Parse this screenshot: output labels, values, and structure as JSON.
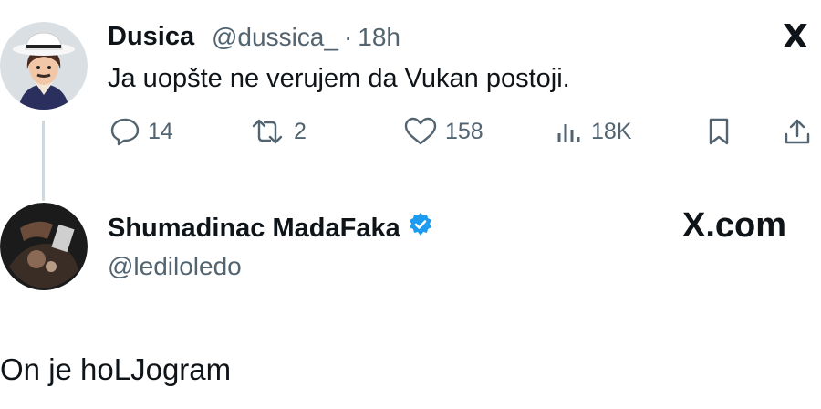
{
  "tweet": {
    "author_name": "Dusica",
    "handle": "@dussica_",
    "separator": "·",
    "time": "18h",
    "text": "Ja uopšte ne verujem da Vukan postoji.",
    "actions": {
      "replies": "14",
      "retweets": "2",
      "likes": "158",
      "views": "18K"
    },
    "platform_icon": "X"
  },
  "reply": {
    "author_name": "Shumadinac MadaFaka",
    "verified": true,
    "handle": "@lediloledo",
    "brand": "X.com",
    "text": "On je hoLJogram"
  },
  "colors": {
    "text": "#0f1419",
    "muted": "#536471",
    "verified_blue": "#1d9bf0",
    "thread_line": "#cfd9de"
  }
}
